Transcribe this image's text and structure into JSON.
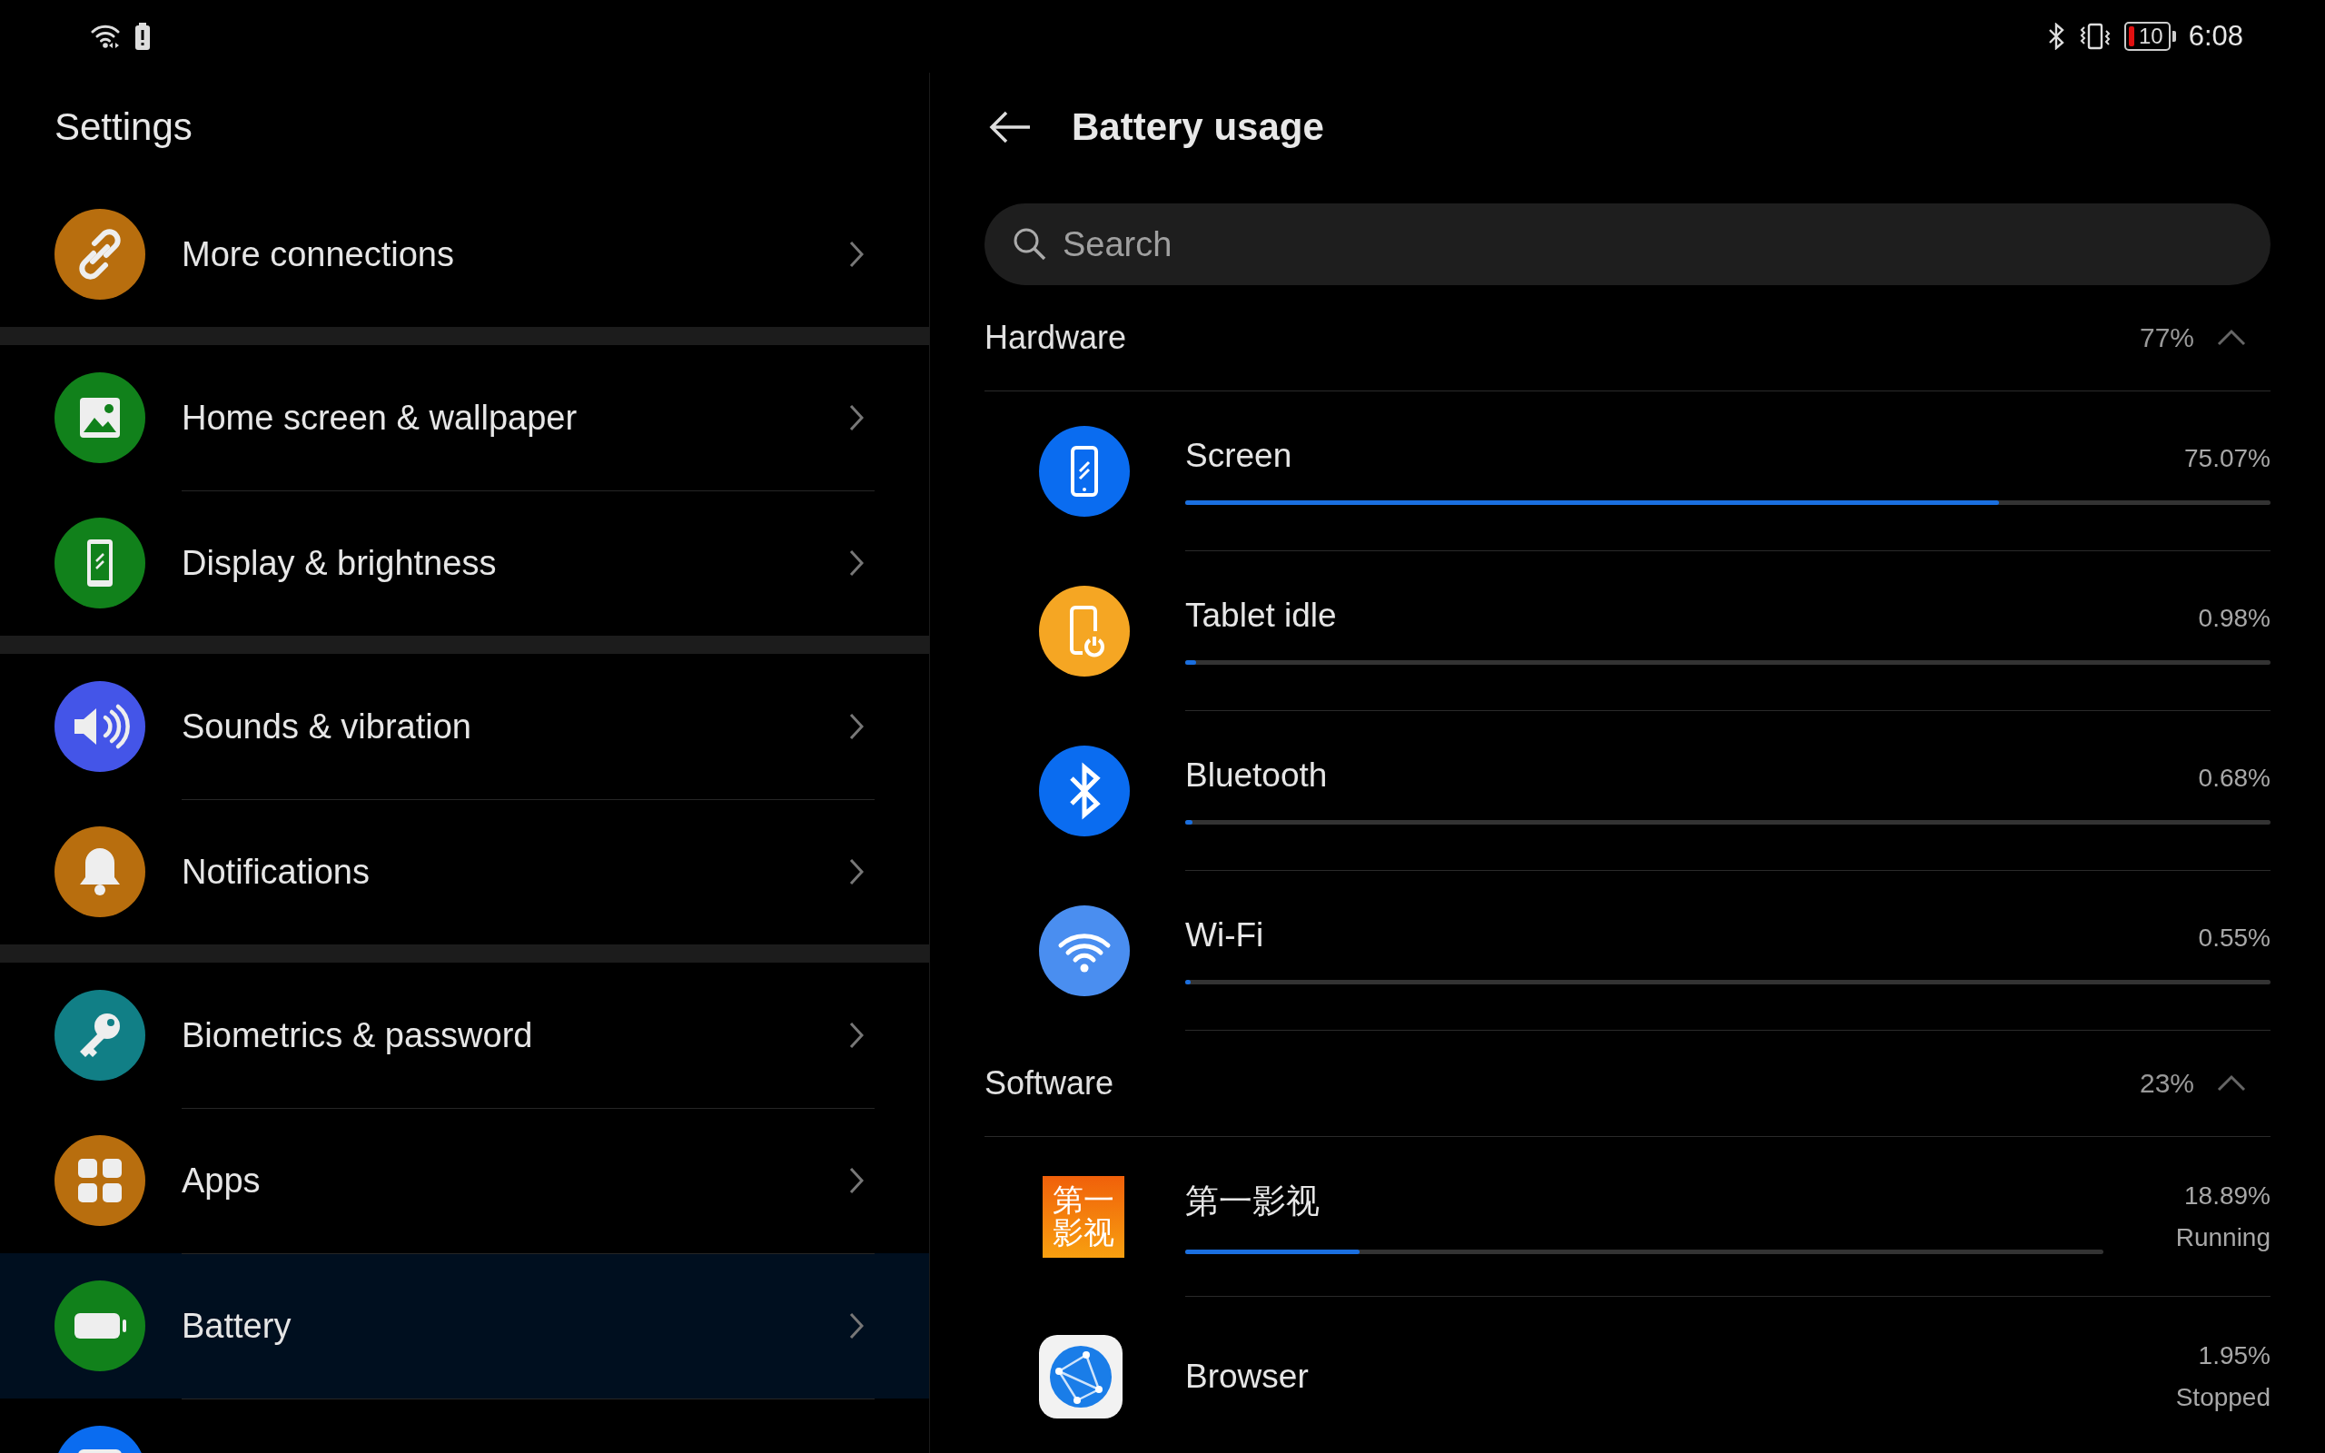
{
  "status_bar": {
    "battery_text": "10",
    "time": "6:08"
  },
  "settings": {
    "title": "Settings",
    "groups": [
      [
        {
          "label": "More connections",
          "kind": "link",
          "color": "#b86e0e",
          "selected": false
        }
      ],
      [
        {
          "label": "Home screen & wallpaper",
          "kind": "image",
          "color": "#11811b",
          "selected": false
        },
        {
          "label": "Display & brightness",
          "kind": "phone",
          "color": "#11811b",
          "selected": false
        }
      ],
      [
        {
          "label": "Sounds & vibration",
          "kind": "speaker",
          "color": "#4455e8",
          "selected": false
        },
        {
          "label": "Notifications",
          "kind": "bell",
          "color": "#b86e0e",
          "selected": false
        }
      ],
      [
        {
          "label": "Biometrics & password",
          "kind": "key",
          "color": "#117f86",
          "selected": false
        },
        {
          "label": "Apps",
          "kind": "grid",
          "color": "#b86e0e",
          "selected": false
        },
        {
          "label": "Battery",
          "kind": "battery",
          "color": "#11811b",
          "selected": true
        },
        {
          "kind": "partial",
          "color": "#0a6cf0",
          "selected": false
        }
      ]
    ]
  },
  "battery_usage": {
    "title": "Battery usage",
    "search": {
      "placeholder": "Search"
    },
    "sections": [
      {
        "title": "Hardware",
        "share": "77%",
        "expanded": true,
        "items": [
          {
            "name": "Screen",
            "kind": "screen",
            "color": "#0a6cf0",
            "percent": "75.07%",
            "level": 0.75
          },
          {
            "name": "Tablet idle",
            "kind": "idle",
            "color": "#f5a623",
            "percent": "0.98%",
            "level": 0.01
          },
          {
            "name": "Bluetooth",
            "kind": "bluetooth",
            "color": "#0a6cf0",
            "percent": "0.68%",
            "level": 0.007
          },
          {
            "name": "Wi-Fi",
            "kind": "wifi",
            "color": "#4a8ef0",
            "percent": "0.55%",
            "level": 0.005
          }
        ]
      },
      {
        "title": "Software",
        "share": "23%",
        "expanded": true,
        "items": [
          {
            "name": "第一影视",
            "kind": "tile",
            "icon_lines": [
              "第一",
              "影视"
            ],
            "percent": "18.89%",
            "status": "Running",
            "level": 0.19
          },
          {
            "name": "Browser",
            "kind": "browser",
            "percent": "1.95%",
            "status": "Stopped"
          }
        ]
      }
    ]
  }
}
